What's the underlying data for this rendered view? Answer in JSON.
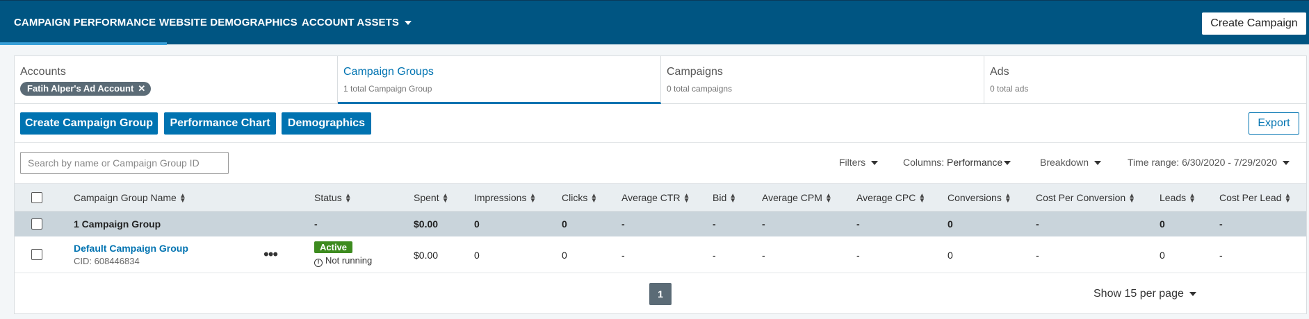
{
  "topnav": {
    "tabs": [
      {
        "label": "CAMPAIGN PERFORMANCE"
      },
      {
        "label": "WEBSITE DEMOGRAPHICS"
      },
      {
        "label": "ACCOUNT ASSETS"
      }
    ],
    "create_campaign": "Create Campaign"
  },
  "account_tabs": {
    "accounts": {
      "title": "Accounts",
      "chip": "Fatih Alper's Ad Account",
      "chip_close": "✕"
    },
    "campaign_groups": {
      "title": "Campaign Groups",
      "subtitle": "1 total Campaign Group"
    },
    "campaigns": {
      "title": "Campaigns",
      "subtitle": "0 total campaigns"
    },
    "ads": {
      "title": "Ads",
      "subtitle": "0 total ads"
    }
  },
  "actions": {
    "create_group": "Create Campaign Group",
    "performance_chart": "Performance Chart",
    "demographics": "Demographics",
    "export": "Export"
  },
  "filterbar": {
    "search_placeholder": "Search by name or Campaign Group ID",
    "filters": "Filters",
    "columns_label": "Columns:",
    "columns_value": "Performance",
    "breakdown": "Breakdown",
    "time_range": "Time range: 6/30/2020 - 7/29/2020"
  },
  "table": {
    "headers": [
      "Campaign Group Name",
      "Status",
      "Spent",
      "Impressions",
      "Clicks",
      "Average CTR",
      "Bid",
      "Average CPM",
      "Average CPC",
      "Conversions",
      "Cost Per Conversion",
      "Leads",
      "Cost Per Lead"
    ],
    "summary": [
      "1 Campaign Group",
      "-",
      "$0.00",
      "0",
      "0",
      "-",
      "-",
      "-",
      "-",
      "0",
      "-",
      "0",
      "-"
    ],
    "rows": [
      {
        "name": "Default Campaign Group",
        "cid": "CID: 608446834",
        "more": "•••",
        "status_badge": "Active",
        "status_note": "Not running",
        "values": [
          "$0.00",
          "0",
          "0",
          "-",
          "-",
          "-",
          "-",
          "0",
          "-",
          "0",
          "-"
        ]
      }
    ]
  },
  "pagination": {
    "page": "1",
    "per_page": "Show 15 per page"
  },
  "colors": {
    "nav": "#005582",
    "primary": "#0073b1",
    "active_badge": "#3d8b1f",
    "summary_row": "#c9d4db"
  }
}
